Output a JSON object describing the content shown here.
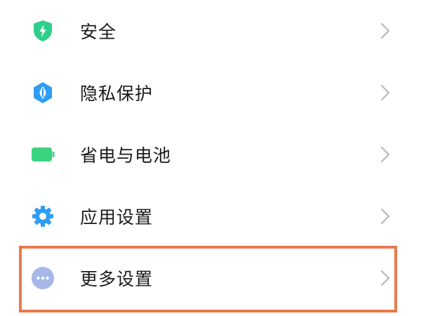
{
  "settings_list": {
    "items": [
      {
        "label": "安全",
        "icon": "shield-lightning-icon",
        "icon_color": "#2fcf8b"
      },
      {
        "label": "隐私保护",
        "icon": "privacy-icon",
        "icon_color": "#2f9df4"
      },
      {
        "label": "省电与电池",
        "icon": "battery-icon",
        "icon_color": "#3bd47e"
      },
      {
        "label": "应用设置",
        "icon": "gear-icon",
        "icon_color": "#2f9df4"
      },
      {
        "label": "更多设置",
        "icon": "more-dots-icon",
        "icon_color": "#a6b7e8"
      }
    ]
  },
  "colors": {
    "highlight_border": "#e8794f",
    "chevron": "#b9b9b9",
    "label_text": "#1a1a1a",
    "background": "#ffffff"
  }
}
